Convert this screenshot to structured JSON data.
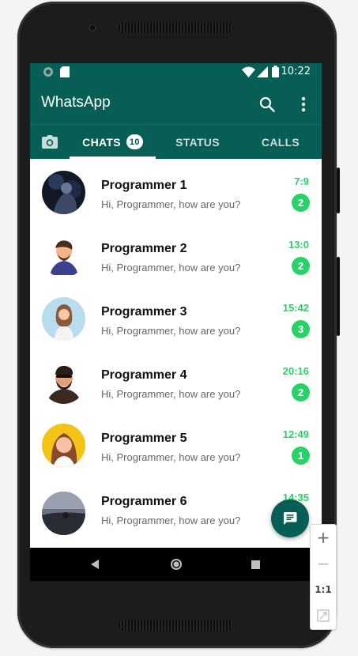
{
  "status_bar": {
    "time": "10:22"
  },
  "app": {
    "title": "WhatsApp"
  },
  "tabs": {
    "chats": "CHATS",
    "chats_badge": "10",
    "status": "STATUS",
    "calls": "CALLS"
  },
  "chats": [
    {
      "name": "Programmer 1",
      "message": "Hi, Programmer, how are you?",
      "time": "7:9",
      "unread": "2"
    },
    {
      "name": "Programmer 2",
      "message": "Hi, Programmer, how are you?",
      "time": "13:0",
      "unread": "2"
    },
    {
      "name": "Programmer 3",
      "message": "Hi, Programmer, how are you?",
      "time": "15:42",
      "unread": "3"
    },
    {
      "name": "Programmer 4",
      "message": "Hi, Programmer, how are you?",
      "time": "20:16",
      "unread": "2"
    },
    {
      "name": "Programmer 5",
      "message": "Hi, Programmer, how are you?",
      "time": "12:49",
      "unread": "1"
    },
    {
      "name": "Programmer 6",
      "message": "Hi, Programmer, how are you?",
      "time": "14:35",
      "unread": ""
    }
  ],
  "zoom_controls": {
    "zoom_in": "+",
    "zoom_out": "−",
    "reset": "1:1"
  },
  "colors": {
    "primary": "#075e54",
    "accent": "#25d366"
  },
  "icons": [
    "search-icon",
    "more-vert-icon",
    "camera-icon",
    "message-icon",
    "back-icon",
    "home-icon",
    "recents-icon",
    "wifi-icon",
    "signal-icon",
    "battery-icon"
  ]
}
